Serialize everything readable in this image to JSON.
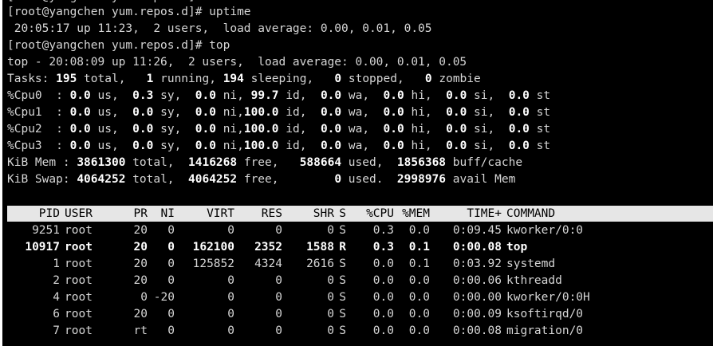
{
  "lines": {
    "l0": "[root@yangchen yum.repos.d]# uptime",
    "l1": " 20:05:17 up 11:23,  2 users,  load average: 0.00, 0.01, 0.05",
    "l2": "[root@yangchen yum.repos.d]# top",
    "l3": "top - 20:08:09 up 11:26,  2 users,  load average: 0.00, 0.01, 0.05"
  },
  "tasks": {
    "label": "Tasks:",
    "total": "195",
    "total_l": " total,   ",
    "running": "1",
    "running_l": " running, ",
    "sleeping": "194",
    "sleeping_l": " sleeping,   ",
    "stopped": "0",
    "stopped_l": " stopped,   ",
    "zombie": "0",
    "zombie_l": " zombie"
  },
  "cpus": [
    {
      "label": "%Cpu0  : ",
      "us": "0.0",
      "sy": "0.3",
      "ni": "0.0",
      "id": " 99.7",
      "wa": "0.0",
      "hi": "0.0",
      "si": "0.0",
      "st": "0.0",
      "ni_sep": " ni,",
      "id_sep": " id,  "
    },
    {
      "label": "%Cpu1  : ",
      "us": "0.0",
      "sy": "0.0",
      "ni": "0.0",
      "id": "100.0",
      "wa": "0.0",
      "hi": "0.0",
      "si": "0.0",
      "st": "0.0",
      "ni_sep": " ni,",
      "id_sep": " id,  "
    },
    {
      "label": "%Cpu2  : ",
      "us": "0.0",
      "sy": "0.0",
      "ni": "0.0",
      "id": "100.0",
      "wa": "0.0",
      "hi": "0.0",
      "si": "0.0",
      "st": "0.0",
      "ni_sep": " ni,",
      "id_sep": " id,  "
    },
    {
      "label": "%Cpu3  : ",
      "us": "0.0",
      "sy": "0.0",
      "ni": "0.0",
      "id": "100.0",
      "wa": "0.0",
      "hi": "0.0",
      "si": "0.0",
      "st": "0.0",
      "ni_sep": " ni,",
      "id_sep": " id,  "
    }
  ],
  "mem": {
    "label": "KiB Mem : ",
    "total": "3861300",
    "free": "1416268",
    "used": "588664",
    "cache": "1856368",
    "total_l": " total,  ",
    "free_l": " free,   ",
    "used_l": " used,  ",
    "cache_l": " buff/cache"
  },
  "swap": {
    "label": "KiB Swap: ",
    "total": "4064252",
    "free": "4064252",
    "used": "0",
    "avail": "2998976",
    "total_l": " total,  ",
    "free_l": " free,        ",
    "used_l": " used.  ",
    "avail_l": " avail Mem"
  },
  "table": {
    "headers": [
      "PID",
      "USER",
      "PR",
      "NI",
      "VIRT",
      "RES",
      "SHR",
      "S",
      "%CPU",
      "%MEM",
      "TIME+",
      "COMMAND"
    ],
    "rows": [
      [
        "9251",
        "root",
        "20",
        "0",
        "0",
        "0",
        "0",
        "S",
        "0.3",
        "0.0",
        "0:09.45",
        "kworker/0:0"
      ],
      [
        "10917",
        "root",
        "20",
        "0",
        "162100",
        "2352",
        "1588",
        "R",
        "0.3",
        "0.1",
        "0:00.08",
        "top"
      ],
      [
        "1",
        "root",
        "20",
        "0",
        "125852",
        "4324",
        "2616",
        "S",
        "0.0",
        "0.1",
        "0:03.92",
        "systemd"
      ],
      [
        "2",
        "root",
        "20",
        "0",
        "0",
        "0",
        "0",
        "S",
        "0.0",
        "0.0",
        "0:00.06",
        "kthreadd"
      ],
      [
        "4",
        "root",
        "0",
        "-20",
        "0",
        "0",
        "0",
        "S",
        "0.0",
        "0.0",
        "0:00.00",
        "kworker/0:0H"
      ],
      [
        "6",
        "root",
        "20",
        "0",
        "0",
        "0",
        "0",
        "S",
        "0.0",
        "0.0",
        "0:00.09",
        "ksoftirqd/0"
      ],
      [
        "7",
        "root",
        "rt",
        "0",
        "0",
        "0",
        "0",
        "S",
        "0.0",
        "0.0",
        "0:00.08",
        "migration/0"
      ]
    ]
  },
  "colors": {
    "bg": "#000000",
    "fg": "#d6d6d6",
    "header_bg": "#e6e6e6"
  }
}
